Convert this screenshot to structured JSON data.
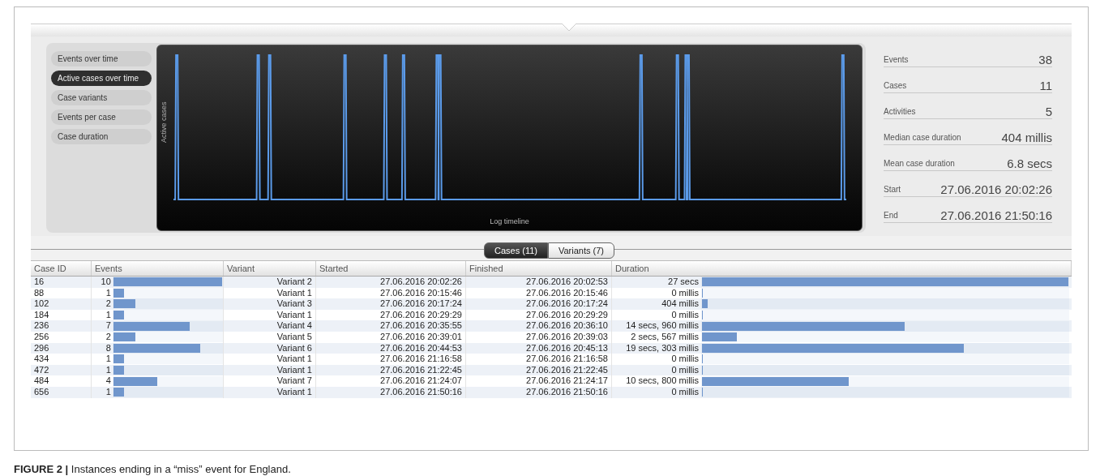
{
  "menu": [
    {
      "label": "Events over time",
      "selected": false
    },
    {
      "label": "Active cases over time",
      "selected": true
    },
    {
      "label": "Case variants",
      "selected": false
    },
    {
      "label": "Events per case",
      "selected": false
    },
    {
      "label": "Case duration",
      "selected": false
    }
  ],
  "chart": {
    "ylabel": "Active cases",
    "xlabel": "Log timeline"
  },
  "stats": [
    {
      "label": "Events",
      "value": "38"
    },
    {
      "label": "Cases",
      "value": "11"
    },
    {
      "label": "Activities",
      "value": "5"
    },
    {
      "label": "Median case duration",
      "value": "404 millis"
    },
    {
      "label": "Mean case duration",
      "value": "6.8 secs"
    },
    {
      "label": "Start",
      "value": "27.06.2016 20:02:26"
    },
    {
      "label": "End",
      "value": "27.06.2016 21:50:16"
    }
  ],
  "tabs": [
    {
      "label": "Cases (11)",
      "selected": true
    },
    {
      "label": "Variants (7)",
      "selected": false
    }
  ],
  "table": {
    "columns": [
      "Case ID",
      "Events",
      "Variant",
      "Started",
      "Finished",
      "Duration"
    ],
    "rows": [
      {
        "case_id": "16",
        "events": {
          "text": "10",
          "level": 1
        },
        "variant": "Variant 2",
        "started": "27.06.2016 20:02:26",
        "finished": "27.06.2016 20:02:53",
        "duration": {
          "text": "27 secs",
          "level": 1
        }
      },
      {
        "case_id": "88",
        "events": {
          "text": "1",
          "level": 0.1
        },
        "variant": "Variant 1",
        "started": "27.06.2016 20:15:46",
        "finished": "27.06.2016 20:15:46",
        "duration": {
          "text": "0 millis",
          "level": 0
        }
      },
      {
        "case_id": "102",
        "events": {
          "text": "2",
          "level": 0.2
        },
        "variant": "Variant 3",
        "started": "27.06.2016 20:17:24",
        "finished": "27.06.2016 20:17:24",
        "duration": {
          "text": "404 millis",
          "level": 0.015
        }
      },
      {
        "case_id": "184",
        "events": {
          "text": "1",
          "level": 0.1
        },
        "variant": "Variant 1",
        "started": "27.06.2016 20:29:29",
        "finished": "27.06.2016 20:29:29",
        "duration": {
          "text": "0 millis",
          "level": 0
        }
      },
      {
        "case_id": "236",
        "events": {
          "text": "7",
          "level": 0.7
        },
        "variant": "Variant 4",
        "started": "27.06.2016 20:35:55",
        "finished": "27.06.2016 20:36:10",
        "duration": {
          "text": "14 secs, 960 millis",
          "level": 0.554
        }
      },
      {
        "case_id": "256",
        "events": {
          "text": "2",
          "level": 0.2
        },
        "variant": "Variant 5",
        "started": "27.06.2016 20:39:01",
        "finished": "27.06.2016 20:39:03",
        "duration": {
          "text": "2 secs, 567 millis",
          "level": 0.095
        }
      },
      {
        "case_id": "296",
        "events": {
          "text": "8",
          "level": 0.8
        },
        "variant": "Variant 6",
        "started": "27.06.2016 20:44:53",
        "finished": "27.06.2016 20:45:13",
        "duration": {
          "text": "19 secs, 303 millis",
          "level": 0.715
        }
      },
      {
        "case_id": "434",
        "events": {
          "text": "1",
          "level": 0.1
        },
        "variant": "Variant 1",
        "started": "27.06.2016 21:16:58",
        "finished": "27.06.2016 21:16:58",
        "duration": {
          "text": "0 millis",
          "level": 0
        }
      },
      {
        "case_id": "472",
        "events": {
          "text": "1",
          "level": 0.1
        },
        "variant": "Variant 1",
        "started": "27.06.2016 21:22:45",
        "finished": "27.06.2016 21:22:45",
        "duration": {
          "text": "0 millis",
          "level": 0
        }
      },
      {
        "case_id": "484",
        "events": {
          "text": "4",
          "level": 0.4
        },
        "variant": "Variant 7",
        "started": "27.06.2016 21:24:07",
        "finished": "27.06.2016 21:24:17",
        "duration": {
          "text": "10 secs, 800 millis",
          "level": 0.4
        }
      },
      {
        "case_id": "656",
        "events": {
          "text": "1",
          "level": 0.1
        },
        "variant": "Variant 1",
        "started": "27.06.2016 21:50:16",
        "finished": "27.06.2016 21:50:16",
        "duration": {
          "text": "0 millis",
          "level": 0
        }
      }
    ]
  },
  "caption": "**FIGURE 2 |** Instances ending in a “miss” event for England."
}
